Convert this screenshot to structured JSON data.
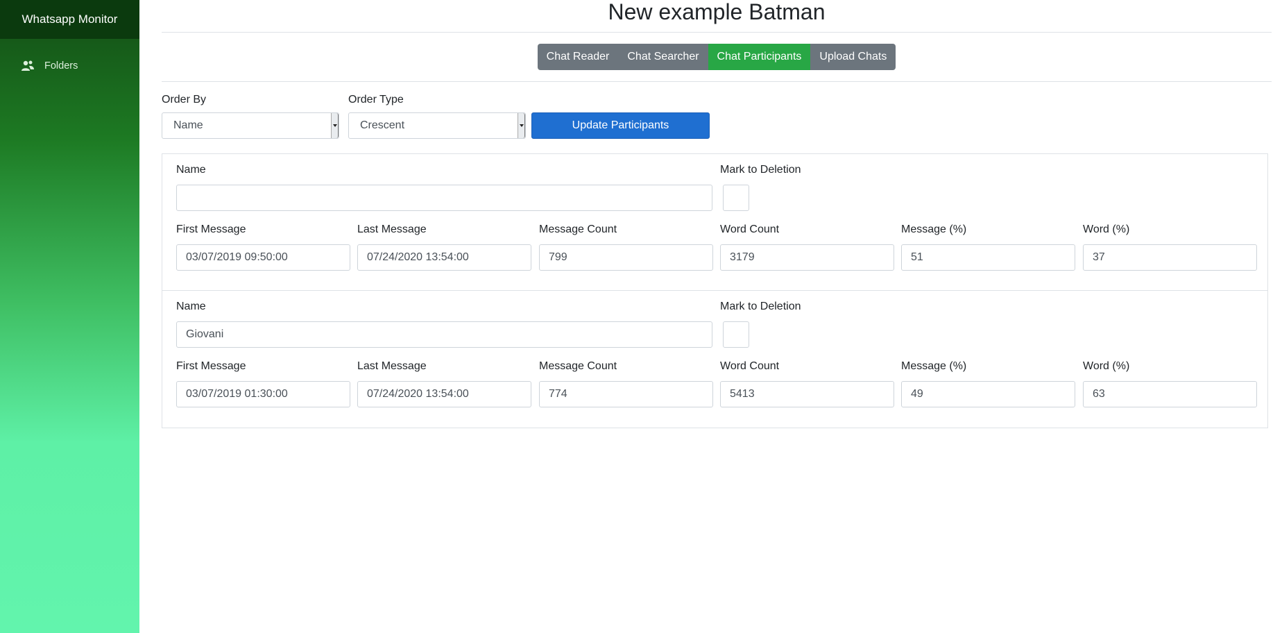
{
  "sidebar": {
    "brand": "Whatsapp Monitor",
    "items": [
      {
        "label": "Folders",
        "icon": "users-icon"
      }
    ]
  },
  "header": {
    "title": "New example Batman"
  },
  "tabs": [
    {
      "label": "Chat Reader",
      "active": false
    },
    {
      "label": "Chat Searcher",
      "active": false
    },
    {
      "label": "Chat Participants",
      "active": true
    },
    {
      "label": "Upload Chats",
      "active": false
    }
  ],
  "filters": {
    "order_by_label": "Order By",
    "order_by_value": "Name",
    "order_type_label": "Order Type",
    "order_type_value": "Crescent",
    "update_button": "Update Participants"
  },
  "labels": {
    "name": "Name",
    "mark": "Mark to Deletion",
    "first_message": "First Message",
    "last_message": "Last Message",
    "message_count": "Message Count",
    "word_count": "Word Count",
    "message_pct": "Message (%)",
    "word_pct": "Word (%)"
  },
  "participants": [
    {
      "name": "",
      "marked": false,
      "first_message": "03/07/2019 09:50:00",
      "last_message": "07/24/2020 13:54:00",
      "message_count": "799",
      "word_count": "3179",
      "message_pct": "51",
      "word_pct": "37"
    },
    {
      "name": "Giovani",
      "marked": false,
      "first_message": "03/07/2019 01:30:00",
      "last_message": "07/24/2020 13:54:00",
      "message_count": "774",
      "word_count": "5413",
      "message_pct": "49",
      "word_pct": "63"
    }
  ],
  "colors": {
    "brand_bg": "#0b3a0e",
    "active_tab": "#28a745",
    "tab": "#6c757d",
    "primary": "#1f6fd1"
  }
}
